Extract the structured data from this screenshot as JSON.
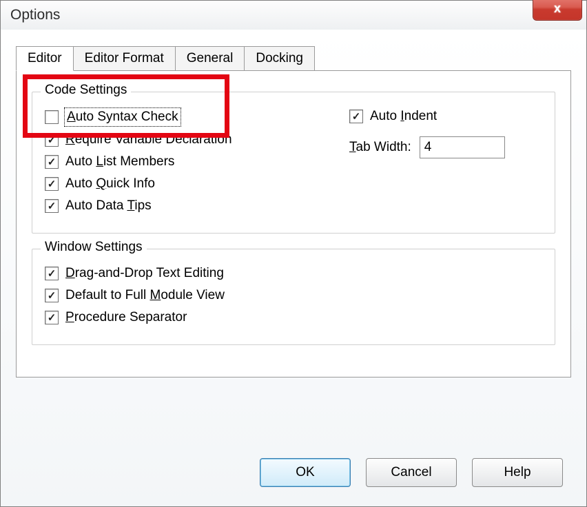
{
  "title": "Options",
  "tabs": [
    "Editor",
    "Editor Format",
    "General",
    "Docking"
  ],
  "active_tab": 0,
  "code_settings": {
    "legend": "Code Settings",
    "left": [
      {
        "label": "Auto Syntax Check",
        "mnemonic_html": "<span class='mn'>A</span>uto Syntax Check",
        "checked": false,
        "focused": true
      },
      {
        "label": "Require Variable Declaration",
        "mnemonic_html": "<span class='mn'>R</span>equire Variable Declaration",
        "checked": true
      },
      {
        "label": "Auto List Members",
        "mnemonic_html": "Auto <span class='mn'>L</span>ist Members",
        "checked": true
      },
      {
        "label": "Auto Quick Info",
        "mnemonic_html": "Auto <span class='mn'>Q</span>uick Info",
        "checked": true
      },
      {
        "label": "Auto Data Tips",
        "mnemonic_html": "Auto Data <span class='mn'>T</span>ips",
        "checked": true
      }
    ],
    "right": {
      "auto_indent": {
        "label": "Auto Indent",
        "mnemonic_html": "Auto <span class='mn'>I</span>ndent",
        "checked": true
      },
      "tab_width_label": "Tab Width:",
      "tab_width_mnemonic_html": "<span class='mn'>T</span>ab Width:",
      "tab_width_value": "4"
    }
  },
  "window_settings": {
    "legend": "Window Settings",
    "items": [
      {
        "label": "Drag-and-Drop Text Editing",
        "mnemonic_html": "<span class='mn'>D</span>rag-and-Drop Text Editing",
        "checked": true
      },
      {
        "label": "Default to Full Module View",
        "mnemonic_html": "Default to Full <span class='mn'>M</span>odule View",
        "checked": true
      },
      {
        "label": "Procedure Separator",
        "mnemonic_html": "<span class='mn'>P</span>rocedure Separator",
        "checked": true
      }
    ]
  },
  "buttons": {
    "ok": "OK",
    "cancel": "Cancel",
    "help": "Help"
  }
}
